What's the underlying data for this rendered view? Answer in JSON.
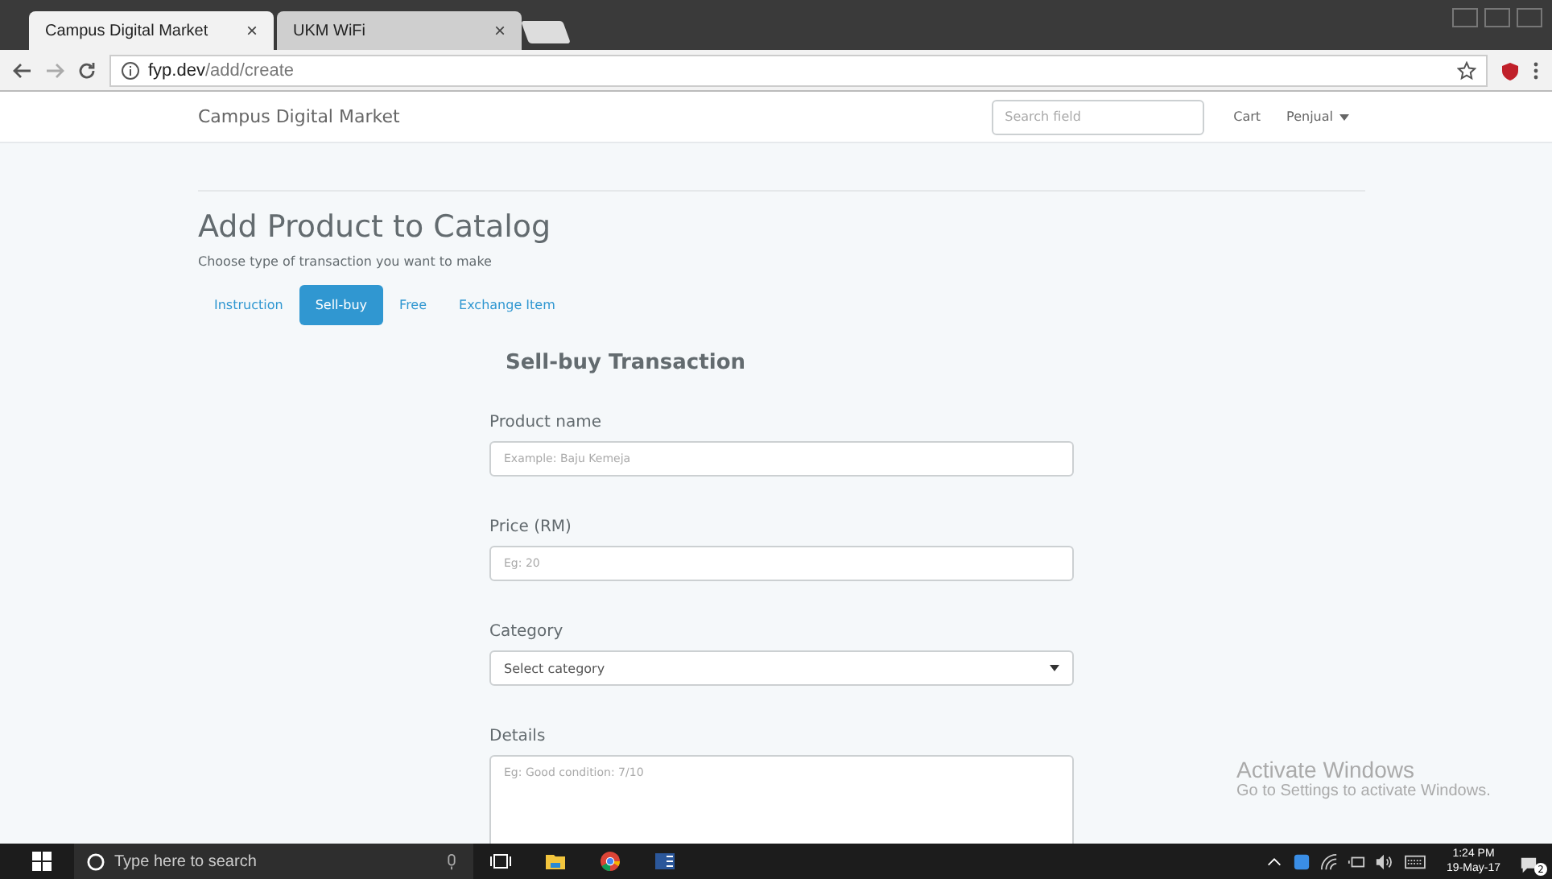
{
  "browser": {
    "tabs": [
      {
        "title": "Campus Digital Market",
        "selected": true,
        "close": "×"
      },
      {
        "title": "UKM WiFi",
        "selected": false,
        "close": "×"
      }
    ],
    "address": {
      "host": "fyp.dev",
      "path": "/add/create"
    }
  },
  "navbar": {
    "brand": "Campus Digital Market",
    "search": {
      "placeholder": "Search field"
    },
    "links": [
      {
        "label": "Cart",
        "dropdown": false
      },
      {
        "label": "Penjual",
        "dropdown": true
      }
    ]
  },
  "page": {
    "title": "Add Product to Catalog",
    "subtitle": "Choose type of transaction you want to make",
    "tabs": [
      {
        "label": "Instruction",
        "selected": false
      },
      {
        "label": "Sell-buy",
        "selected": true
      },
      {
        "label": "Free",
        "selected": false
      },
      {
        "label": "Exchange Item",
        "selected": false
      }
    ],
    "form": {
      "title": "Sell-buy Transaction",
      "fields": [
        {
          "kind": "text",
          "label": "Product name",
          "placeholder": "Example: Baju Kemeja"
        },
        {
          "kind": "text",
          "label": "Price (RM)",
          "placeholder": "Eg: 20"
        },
        {
          "kind": "select",
          "label": "Category",
          "value": "Select category"
        },
        {
          "kind": "textarea",
          "label": "Details",
          "placeholder": "Eg: Good condition: 7/10"
        }
      ]
    }
  },
  "activation": {
    "title": "Activate Windows",
    "message": "Go to Settings to activate Windows."
  },
  "taskbar": {
    "search": {
      "placeholder": "Type here to search"
    },
    "time": "1:24 PM",
    "date": "19-May-17",
    "notifications": "2"
  }
}
